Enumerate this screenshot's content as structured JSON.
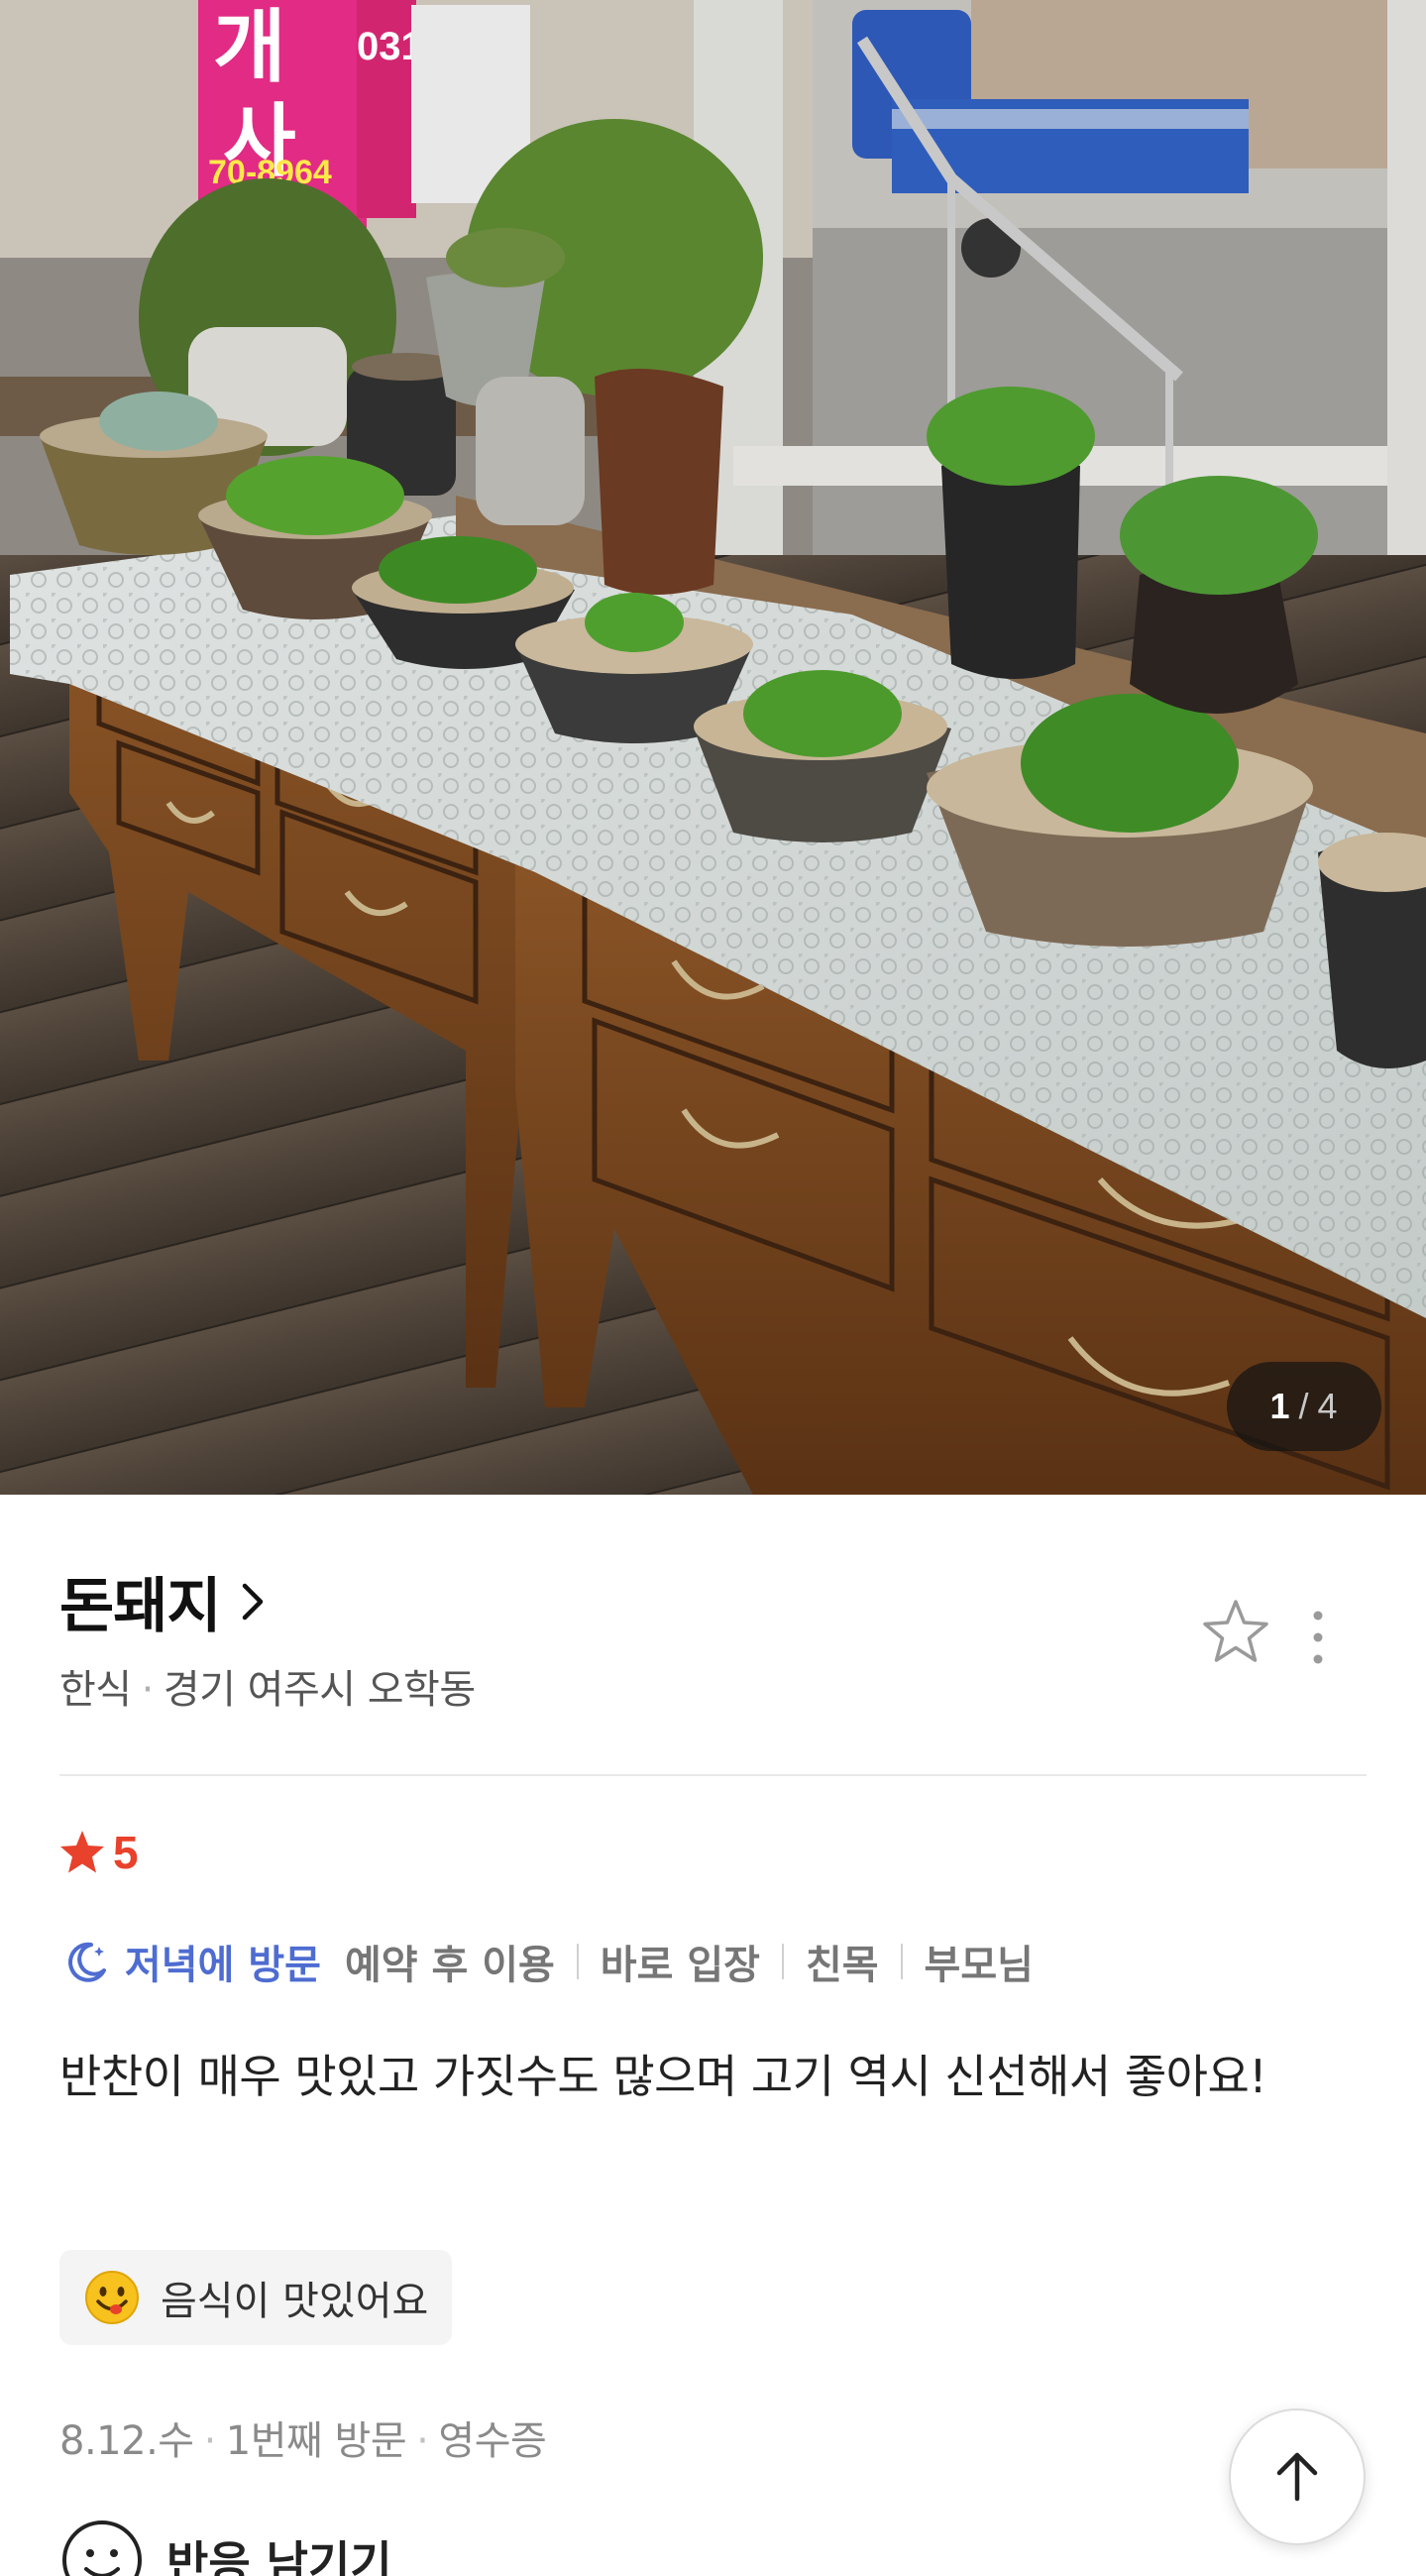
{
  "carousel": {
    "current": "1",
    "separator": "/",
    "total": "4"
  },
  "place": {
    "name": "돈돼지",
    "category": "한식",
    "location": "경기 여주시 오학동"
  },
  "review": {
    "rating": "5",
    "visit_time": "저녁에 방문",
    "tags": [
      "예약 후 이용",
      "바로 입장",
      "친목",
      "부모님"
    ],
    "text": "반찬이 매우 맛있고 가짓수도 많으며 고기 역시 신선해서 좋아요!",
    "keyword": "음식이 맛있어요",
    "date": "8.12.수",
    "visit_count": "1번째 방문",
    "verification": "영수증",
    "reaction_label": "반응 남기기"
  },
  "signs": {
    "store_text_1": "개",
    "store_text_2": "사",
    "phone": "70-8964",
    "store_num": "031"
  },
  "colors": {
    "rating": "#e8412c",
    "visit": "#4e6cd1",
    "tag": "#767676"
  },
  "icons": {
    "title_chevron": "chevron-right-icon",
    "favorite": "star-outline-icon",
    "more": "more-vertical-icon",
    "rating": "star-filled-icon",
    "visit_time": "moon-icon",
    "keyword": "smiley-emoji-icon",
    "reaction": "smile-face-icon",
    "scroll_top": "arrow-up-icon"
  }
}
